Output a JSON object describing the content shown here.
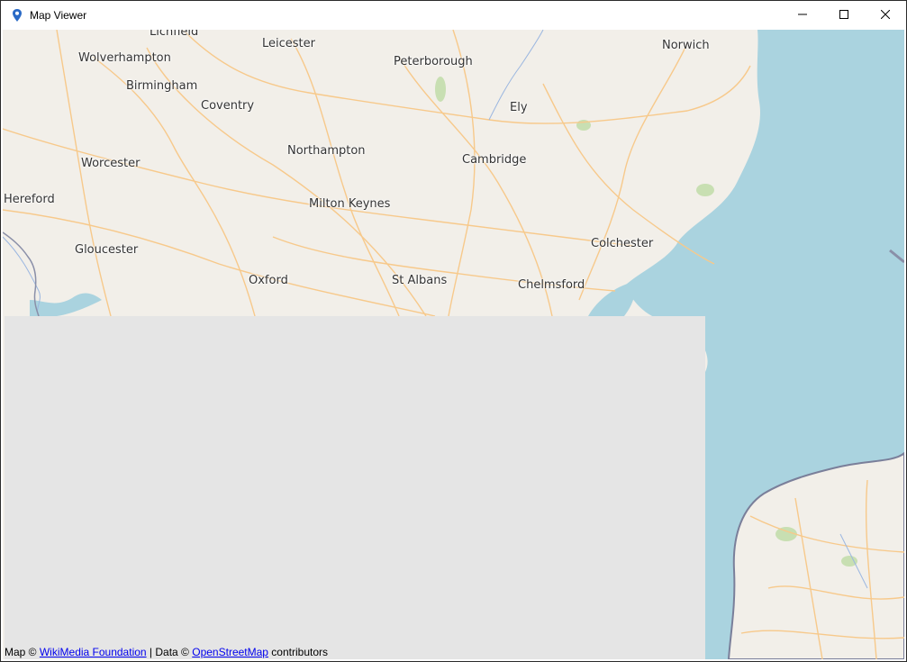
{
  "window": {
    "title": "Map Viewer"
  },
  "icons": {
    "app": "map-pin-icon",
    "minimize": "minimize-icon",
    "maximize": "maximize-icon",
    "close": "close-icon"
  },
  "colors": {
    "land": "#f2efe9",
    "sea": "#aad3df",
    "missing_tile": "#e5e5e5",
    "road": "#f7c98b",
    "link": "#0000ee",
    "pin": "#2a6ac6"
  },
  "map": {
    "cities": [
      {
        "id": "lichfield",
        "name": "Lichfield"
      },
      {
        "id": "leicester",
        "name": "Leicester"
      },
      {
        "id": "norwich",
        "name": "Norwich"
      },
      {
        "id": "wolverhampton",
        "name": "Wolverhampton"
      },
      {
        "id": "peterborough",
        "name": "Peterborough"
      },
      {
        "id": "birmingham",
        "name": "Birmingham"
      },
      {
        "id": "ely",
        "name": "Ely"
      },
      {
        "id": "coventry",
        "name": "Coventry"
      },
      {
        "id": "northampton",
        "name": "Northampton"
      },
      {
        "id": "worcester",
        "name": "Worcester"
      },
      {
        "id": "cambridge",
        "name": "Cambridge"
      },
      {
        "id": "hereford",
        "name": "Hereford"
      },
      {
        "id": "milton-keynes",
        "name": "Milton Keynes"
      },
      {
        "id": "colchester",
        "name": "Colchester"
      },
      {
        "id": "gloucester",
        "name": "Gloucester"
      },
      {
        "id": "oxford",
        "name": "Oxford"
      },
      {
        "id": "st-albans",
        "name": "St Albans"
      },
      {
        "id": "chelmsford",
        "name": "Chelmsford"
      }
    ]
  },
  "attribution": {
    "prefix": "Map © ",
    "map_link": "WikiMedia Foundation",
    "middle": " | Data © ",
    "data_link": "OpenStreetMap",
    "suffix": " contributors"
  }
}
